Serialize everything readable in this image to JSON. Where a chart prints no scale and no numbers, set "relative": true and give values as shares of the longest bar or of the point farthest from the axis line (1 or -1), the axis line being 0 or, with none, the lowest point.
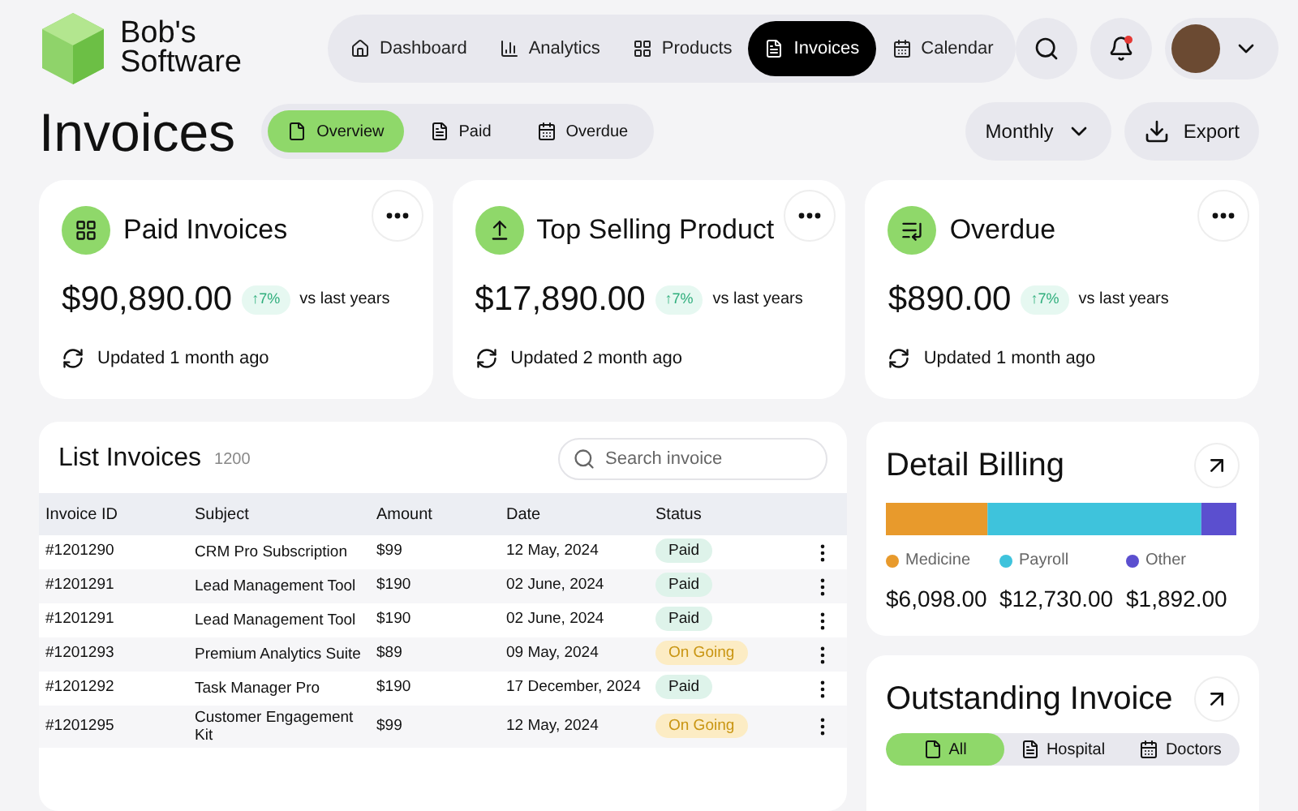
{
  "brand": {
    "name_line1": "Bob's",
    "name_line2": "Software"
  },
  "nav": [
    {
      "label": "Dashboard",
      "selected": false
    },
    {
      "label": "Analytics",
      "selected": false
    },
    {
      "label": "Products",
      "selected": false
    },
    {
      "label": "Invoices",
      "selected": true
    },
    {
      "label": "Calendar",
      "selected": false
    }
  ],
  "notifications": {
    "unread": true
  },
  "page_title": "Invoices",
  "view_tabs": [
    {
      "label": "Overview",
      "selected": true
    },
    {
      "label": "Paid",
      "selected": false
    },
    {
      "label": "Overdue",
      "selected": false
    }
  ],
  "period_select": "Monthly",
  "export_button": "Export",
  "stat_cards": [
    {
      "title": "Paid Invoices",
      "value": "$90,890.00",
      "change": "↑7%",
      "compare": "vs last years",
      "updated": "Updated 1 month ago"
    },
    {
      "title": "Top Selling Product",
      "value": "$17,890.00",
      "change": "↑7%",
      "compare": "vs last years",
      "updated": "Updated 2 month ago"
    },
    {
      "title": "Overdue",
      "value": "$890.00",
      "change": "↑7%",
      "compare": "vs last years",
      "updated": "Updated 1 month ago"
    }
  ],
  "invoice_list": {
    "title": "List Invoices",
    "count": "1200",
    "search": {
      "placeholder": "Search invoice"
    },
    "columns": [
      "Invoice ID",
      "Subject",
      "Amount",
      "Date",
      "Status"
    ],
    "rows": [
      {
        "id": "#1201290",
        "subject": "CRM Pro Subscription",
        "amount": "$99",
        "date": "12 May, 2024",
        "status": "Paid",
        "kind": "paid"
      },
      {
        "id": "#1201291",
        "subject": "Lead Management Tool",
        "amount": "$190",
        "date": "02 June, 2024",
        "status": "Paid",
        "kind": "paid"
      },
      {
        "id": "#1201291",
        "subject": "Lead Management Tool",
        "amount": "$190",
        "date": "02 June, 2024",
        "status": "Paid",
        "kind": "paid"
      },
      {
        "id": "#1201293",
        "subject": "Premium Analytics Suite",
        "amount": "$89",
        "date": "09 May, 2024",
        "status": "On Going",
        "kind": "ongoing"
      },
      {
        "id": "#1201292",
        "subject": "Task Manager Pro",
        "amount": "$190",
        "date": "17 December, 2024",
        "status": "Paid",
        "kind": "paid"
      },
      {
        "id": "#1201295",
        "subject": "Customer Engagement Kit",
        "amount": "$99",
        "date": "12 May, 2024",
        "status": "On Going",
        "kind": "ongoing"
      }
    ]
  },
  "detail_billing": {
    "title": "Detail Billing",
    "chart_data": {
      "type": "bar",
      "orientation": "horizontal",
      "stacked": true,
      "series": [
        {
          "name": "Medicine",
          "color": "#e89a2c",
          "values": [
            0.29
          ]
        },
        {
          "name": "Payroll",
          "color": "#3ec3dc",
          "values": [
            0.61
          ]
        },
        {
          "name": "Other",
          "color": "#5b4fcf",
          "values": [
            0.1
          ]
        }
      ],
      "legend": "bottom",
      "relative": true
    },
    "amounts": [
      "$6,098.00",
      "$12,730.00",
      "$1,892.00"
    ]
  },
  "outstanding": {
    "title": "Outstanding Invoice",
    "tabs": [
      {
        "label": "All",
        "selected": true
      },
      {
        "label": "Hospital",
        "selected": false
      },
      {
        "label": "Doctors",
        "selected": false
      }
    ]
  }
}
